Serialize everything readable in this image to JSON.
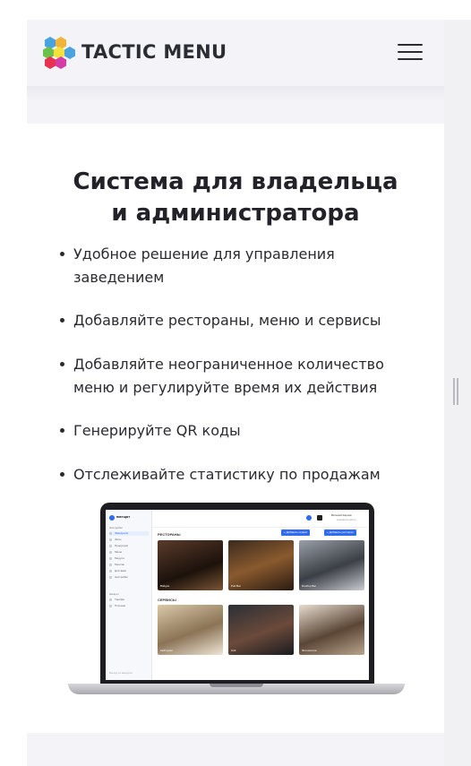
{
  "header": {
    "brand": "TACTIC MENU",
    "menu_icon": "hamburger-menu-icon",
    "logo_icon": "hexagon-cluster-logo",
    "logo_colors": [
      "#4aa3df",
      "#f2b33d",
      "#6cc24a",
      "#e8324f",
      "#f7e23b",
      "#d63ca7"
    ]
  },
  "card": {
    "title_line1": "Система для владельца",
    "title_line2": "и администратора",
    "features": [
      "Удобное решение для управления заведением",
      "Добавляйте рестораны, меню и сервисы",
      "Добавляйте неограниченное количество меню и регулируйте время их действия",
      "Генерируйте QR коды",
      "Отслеживайте статистику по продажам"
    ]
  },
  "laptop": {
    "app_name": "вмещат",
    "nav_section": "Настройки",
    "nav_items": [
      "Заведения",
      "Залы",
      "Продукция",
      "Меню",
      "Модули",
      "Монтаж",
      "Доставка",
      "Настройки"
    ],
    "nav_section2": "Аккаунт",
    "nav_items2": [
      "Тарифы",
      "Платежи"
    ],
    "footer_text": "Выход из аккаунта",
    "restaurants_title": "РЕСТОРАНЫ",
    "services_title": "СЕРВИСЫ",
    "add_service_btn": "+ Добавить сервис",
    "add_restaurant_btn": "+ Добавить ресторан",
    "user_name": "Виталий Карпов",
    "user_role": "Администратор",
    "restaurants": [
      "Вэйдин",
      "Pub Bar",
      "Rooftop Bar"
    ],
    "services": [
      "Кейтеринг",
      "Grill",
      "Фотосессия"
    ]
  }
}
